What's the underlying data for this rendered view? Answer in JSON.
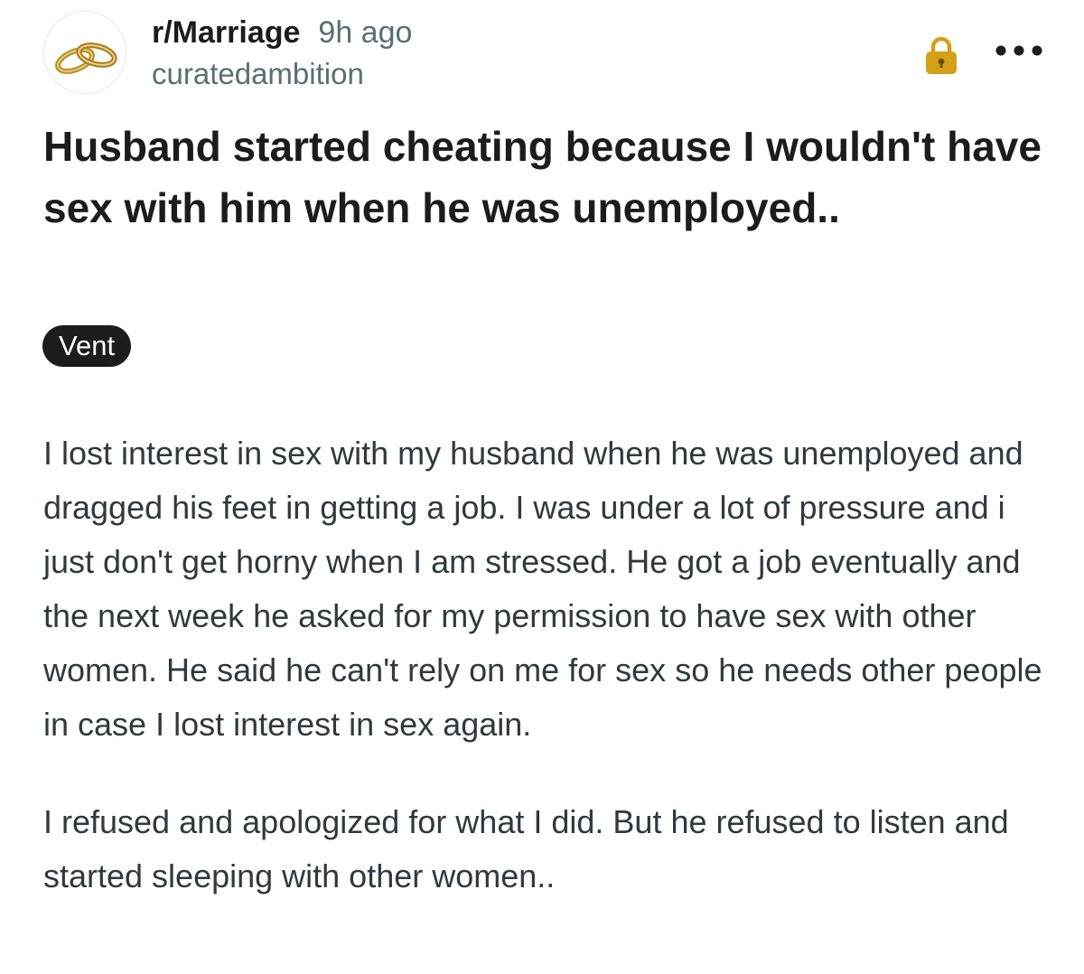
{
  "post": {
    "subreddit": "r/Marriage",
    "time": "9h ago",
    "author": "curatedambition",
    "title": "Husband started cheating because I wouldn't have sex with him when he was unemployed..",
    "flair": "Vent",
    "paragraphs": [
      "I lost interest in sex with my husband when he was unemployed and dragged his feet in getting a job. I was under a lot of pressure and i just don't get horny when I am stressed. He got a job eventually and the next week he asked for my permission to have sex with other women. He said he can't rely on me for sex so he needs other people in case I lost interest in sex again.",
      "I refused and apologized for what I did. But he refused to listen and started sleeping with other women.."
    ],
    "icons": {
      "avatar": "wedding-rings-icon",
      "lock": "lock-icon",
      "more": "more-options-icon"
    },
    "colors": {
      "lock": "#d4a017",
      "flair_background": "#1c1c1c",
      "secondary_text": "#576f76"
    }
  }
}
